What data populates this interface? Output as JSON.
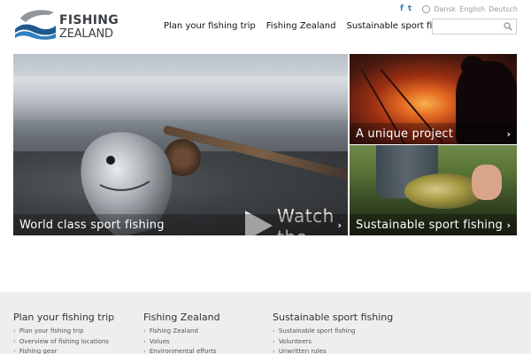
{
  "brand": {
    "line1": "FISHING",
    "line2": "ZEALAND",
    "colors": {
      "blue": "#1f5a8c",
      "gray": "#3b3f44"
    }
  },
  "topbar": {
    "social": [
      {
        "icon": "facebook-icon",
        "glyph": "f"
      },
      {
        "icon": "twitter-icon",
        "glyph": "t"
      }
    ],
    "languages": [
      "Dansk",
      "English",
      "Deutsch"
    ]
  },
  "nav": {
    "items": [
      "Plan your fishing trip",
      "Fishing Zealand",
      "Sustainable sport fishing"
    ]
  },
  "search": {
    "placeholder": ""
  },
  "hero": {
    "main": {
      "caption": "World class sport fishing",
      "watch_line1": "Watch",
      "watch_line2": "the film"
    },
    "top_right": {
      "caption": "A unique project"
    },
    "bottom_right": {
      "caption": "Sustainable sport fishing"
    }
  },
  "footer": {
    "columns": [
      {
        "title": "Plan your fishing trip",
        "links": [
          "Plan your fishing trip",
          "Overview of fishing locations",
          "Fishing gear"
        ]
      },
      {
        "title": "Fishing Zealand",
        "links": [
          "Fishing Zealand",
          "Values",
          "Environmental efforts"
        ]
      },
      {
        "title": "Sustainable sport fishing",
        "links": [
          "Sustainable sport fishing",
          "Volunteers",
          "Unwritten rules"
        ]
      }
    ]
  }
}
